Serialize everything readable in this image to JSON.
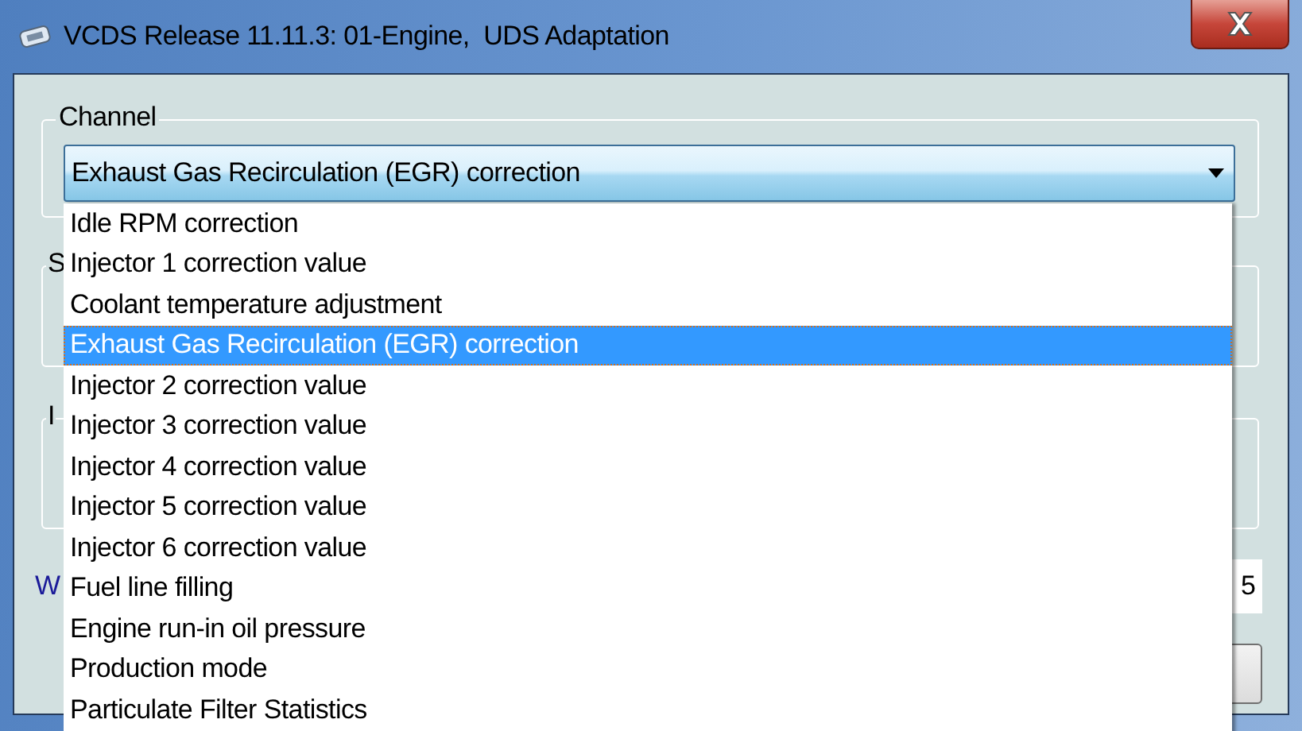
{
  "window": {
    "title": "VCDS Release 11.11.3: 01-Engine,  UDS Adaptation"
  },
  "channel": {
    "label": "Channel",
    "value": "Exhaust Gas Recirculation (EGR) correction",
    "expanded": true,
    "options": [
      {
        "label": "Idle RPM correction",
        "selected": false
      },
      {
        "label": "Injector 1 correction value",
        "selected": false
      },
      {
        "label": "Coolant temperature adjustment",
        "selected": false
      },
      {
        "label": "Exhaust Gas Recirculation (EGR) correction",
        "selected": true
      },
      {
        "label": "Injector 2 correction value",
        "selected": false
      },
      {
        "label": "Injector 3 correction value",
        "selected": false
      },
      {
        "label": "Injector 4 correction value",
        "selected": false
      },
      {
        "label": "Injector 5 correction value",
        "selected": false
      },
      {
        "label": "Injector 6 correction value",
        "selected": false
      },
      {
        "label": "Fuel line filling",
        "selected": false
      },
      {
        "label": "Engine run-in oil pressure",
        "selected": false
      },
      {
        "label": "Production mode",
        "selected": false
      },
      {
        "label": "Particulate Filter Statistics",
        "selected": false
      }
    ]
  },
  "group_2": {
    "label": "S"
  },
  "group_3": {
    "label": "I"
  },
  "field_row": {
    "label": "W",
    "value": "5"
  }
}
